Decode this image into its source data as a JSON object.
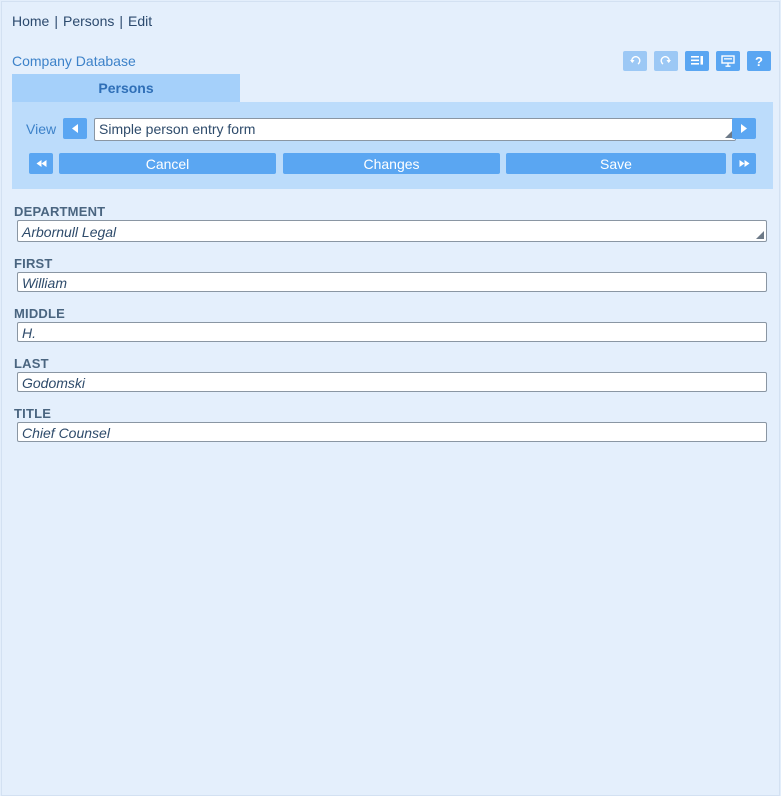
{
  "breadcrumb": {
    "home": "Home",
    "persons": "Persons",
    "edit": "Edit",
    "sep": "|"
  },
  "app": {
    "title": "Company Database"
  },
  "toolbar": {
    "help_label": "?"
  },
  "tab": {
    "label": "Persons"
  },
  "view": {
    "label": "View",
    "selected": "Simple person entry form"
  },
  "actions": {
    "cancel": "Cancel",
    "changes": "Changes",
    "save": "Save"
  },
  "form": {
    "fields": [
      {
        "label": "DEPARTMENT",
        "value": "Arbornull Legal"
      },
      {
        "label": "FIRST",
        "value": "William"
      },
      {
        "label": "MIDDLE",
        "value": "H."
      },
      {
        "label": "LAST",
        "value": "Godomski"
      },
      {
        "label": "TITLE",
        "value": "Chief Counsel"
      }
    ]
  },
  "colors": {
    "accent": "#5aa6f2",
    "tab_bg": "#a5d0fa",
    "panel_bg": "#bcdcfb",
    "page_bg": "#e4effc"
  },
  "icons": [
    "undo-icon",
    "redo-icon",
    "list-settings-icon",
    "presentation-icon",
    "help-icon",
    "arrow-left-icon",
    "arrow-right-icon",
    "first-record-icon",
    "last-record-icon"
  ]
}
